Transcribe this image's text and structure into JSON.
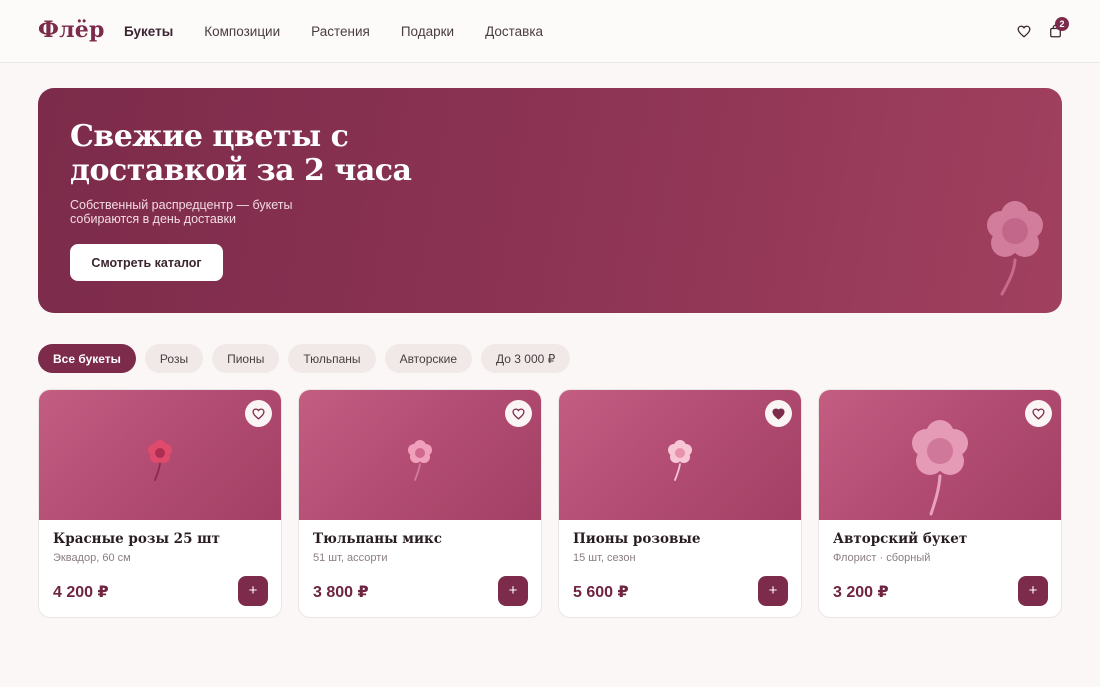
{
  "header": {
    "logo": "Флёр",
    "nav": [
      "Букеты",
      "Композиции",
      "Растения",
      "Подарки",
      "Доставка"
    ],
    "active_nav": "Букеты",
    "cart_count": "2",
    "icons": {
      "favorites": "heart-icon",
      "cart": "shopping-bag-icon"
    }
  },
  "hero": {
    "title": "Свежие цветы с доставкой за 2 часа",
    "subtitle": "Собственный распредцентр — букеты собираются в день доставки",
    "button": "Смотреть каталог"
  },
  "filters": {
    "items": [
      "Все букеты",
      "Розы",
      "Пионы",
      "Тюльпаны",
      "Авторские",
      "До 3 000 ₽"
    ],
    "active": "Все букеты"
  },
  "products": [
    {
      "name": "Красные розы 25 шт",
      "desc": "Эквадор, 60 см",
      "price": "4 200 ₽",
      "favorite": false,
      "add": "+"
    },
    {
      "name": "Тюльпаны микс",
      "desc": "51 шт, ассорти",
      "price": "3 800 ₽",
      "favorite": false,
      "add": "+"
    },
    {
      "name": "Пионы розовые",
      "desc": "15 шт, сезон",
      "price": "5 600 ₽",
      "favorite": true,
      "add": "+"
    },
    {
      "name": "Авторский букет",
      "desc": "Флорист · сборный",
      "price": "3 200 ₽",
      "favorite": false,
      "add": "+"
    }
  ],
  "colors": {
    "brand": "#7c2b4a",
    "background": "#faf7f6",
    "chip": "#f1e9e8"
  }
}
